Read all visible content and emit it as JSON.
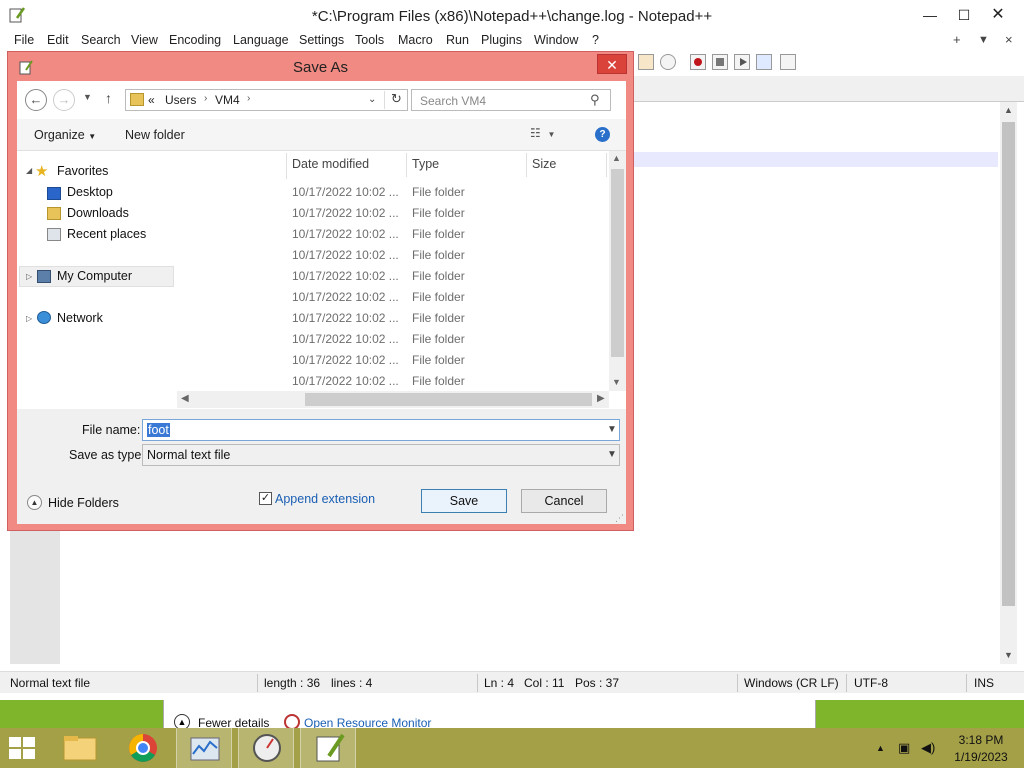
{
  "npp": {
    "title": "*C:\\Program Files (x86)\\Notepad++\\change.log - Notepad++",
    "menu": [
      "File",
      "Edit",
      "Search",
      "View",
      "Encoding",
      "Language",
      "Settings",
      "Tools",
      "Macro",
      "Run",
      "Plugins",
      "Window",
      "?"
    ],
    "menu_right": [
      "+",
      "▼",
      "×"
    ],
    "status": {
      "file_type": "Normal text file",
      "length": "length : 36",
      "lines": "lines : 4",
      "ln": "Ln : 4",
      "col": "Col : 11",
      "pos": "Pos : 37",
      "eol": "Windows (CR LF)",
      "encoding": "UTF-8",
      "mode": "INS"
    }
  },
  "resource_monitor": {
    "fewer_details": "Fewer details",
    "open_rm": "Open Resource Monitor"
  },
  "dialog": {
    "title": "Save As",
    "address": {
      "overflow": "«",
      "crumbs": [
        "Users",
        "VM4"
      ]
    },
    "search_placeholder": "Search VM4",
    "organize": "Organize",
    "new_folder": "New folder",
    "nav": {
      "favorites": "Favorites",
      "desktop": "Desktop",
      "downloads": "Downloads",
      "recent": "Recent places",
      "computer": "My Computer",
      "network": "Network"
    },
    "columns": {
      "date": "Date modified",
      "type": "Type",
      "size": "Size"
    },
    "rows": [
      {
        "date": "10/17/2022 10:02 ...",
        "type": "File folder"
      },
      {
        "date": "10/17/2022 10:02 ...",
        "type": "File folder"
      },
      {
        "date": "10/17/2022 10:02 ...",
        "type": "File folder"
      },
      {
        "date": "10/17/2022 10:02 ...",
        "type": "File folder"
      },
      {
        "date": "10/17/2022 10:02 ...",
        "type": "File folder"
      },
      {
        "date": "10/17/2022 10:02 ...",
        "type": "File folder"
      },
      {
        "date": "10/17/2022 10:02 ...",
        "type": "File folder"
      },
      {
        "date": "10/17/2022 10:02 ...",
        "type": "File folder"
      },
      {
        "date": "10/17/2022 10:02 ...",
        "type": "File folder"
      },
      {
        "date": "10/17/2022 10:02 ...",
        "type": "File folder"
      }
    ],
    "file_name_label": "File name:",
    "file_name_value": "foot",
    "save_type_label": "Save as type:",
    "save_type_value": "Normal text file",
    "hide_folders": "Hide Folders",
    "append_extension": "Append extension",
    "save": "Save",
    "cancel": "Cancel"
  },
  "taskbar": {
    "time": "3:18 PM",
    "date": "1/19/2023"
  },
  "colors": {
    "dialog_frame": "#f08a82",
    "close_button": "#d9433a",
    "taskbar": "#a4a048",
    "desktop_green": "#7fb52b",
    "link_blue": "#1a5fb4"
  }
}
